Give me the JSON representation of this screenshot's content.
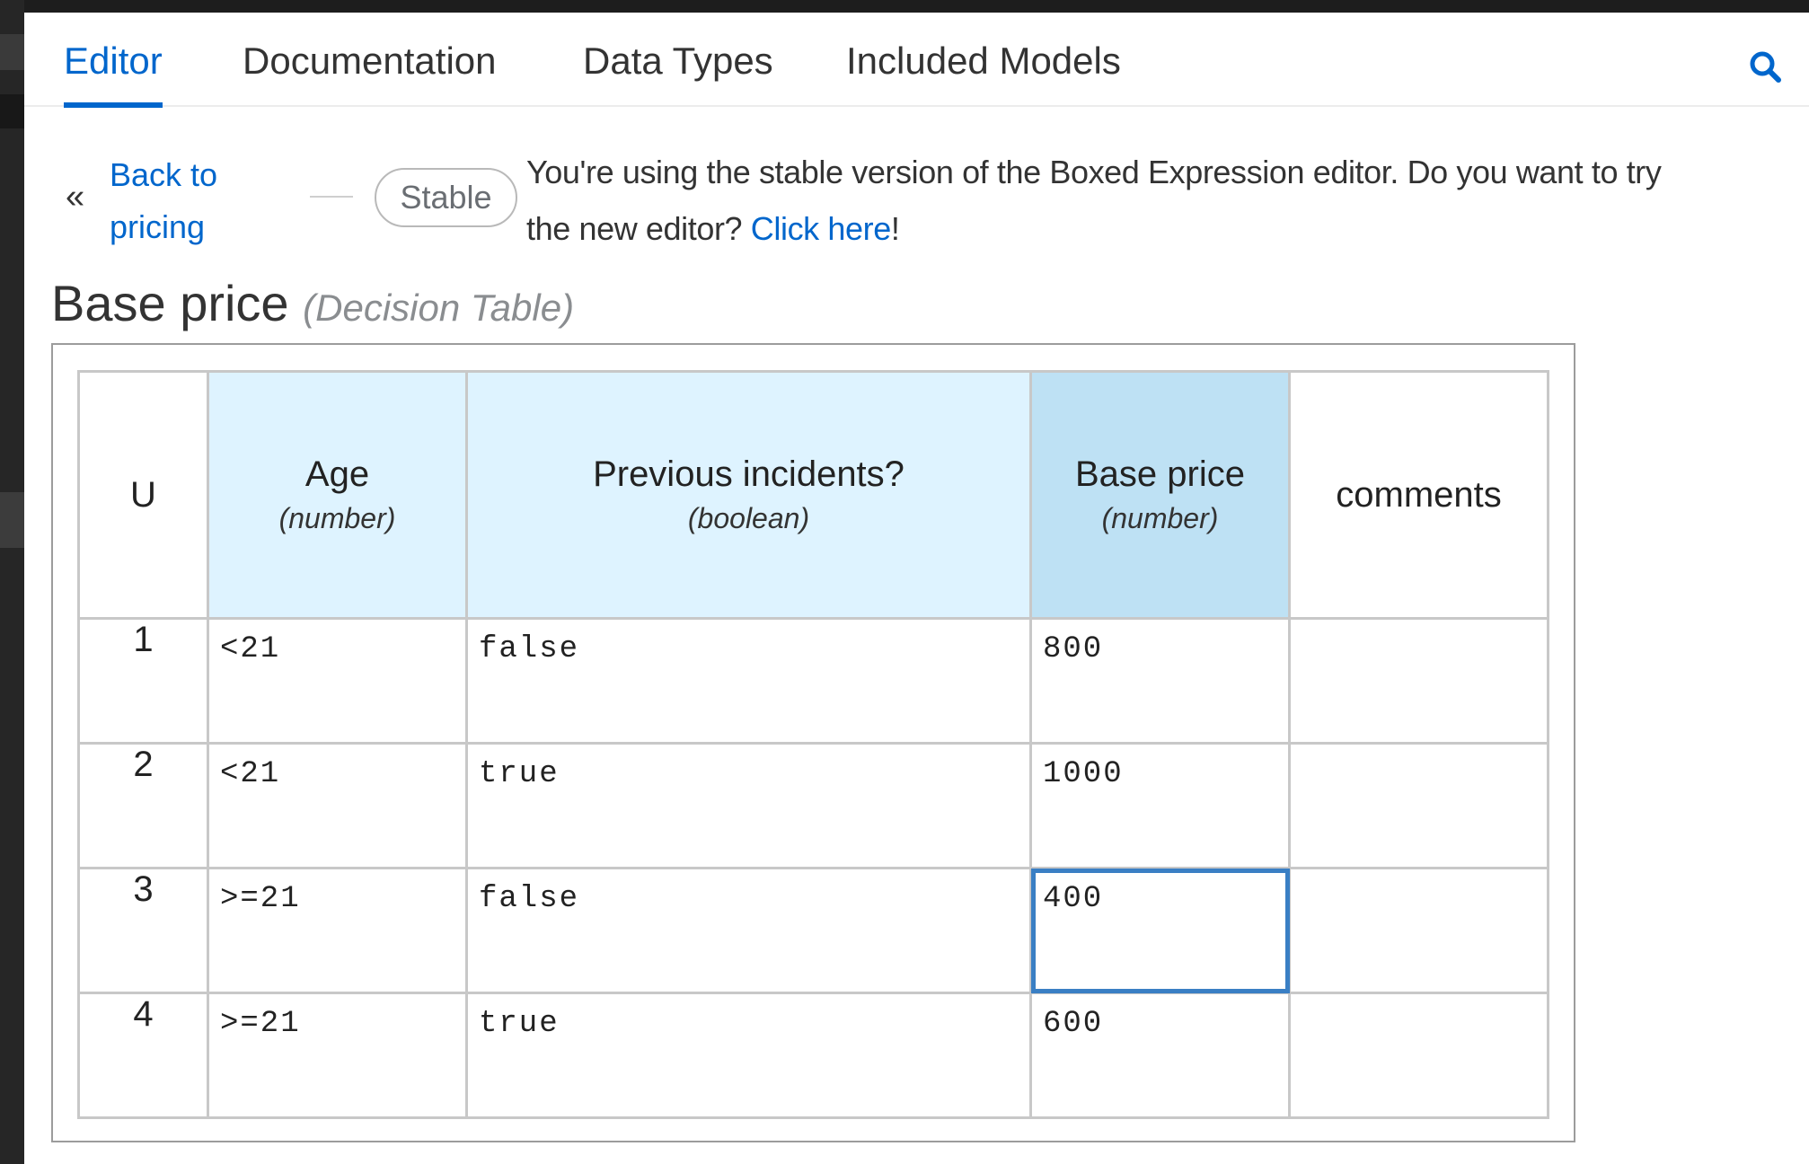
{
  "tabs": [
    {
      "label": "Editor",
      "active": true
    },
    {
      "label": "Documentation",
      "active": false
    },
    {
      "label": "Data Types",
      "active": false
    },
    {
      "label": "Included Models",
      "active": false
    }
  ],
  "back_link": {
    "line1": "Back to",
    "line2": "pricing"
  },
  "badge": "Stable",
  "notice": {
    "line1": "You're using the stable version of the Boxed Expression editor. Do you want to try",
    "line2_before": "the new editor? ",
    "link": "Click here",
    "line2_after": "!"
  },
  "expression": {
    "name": "Base price",
    "type": "(Decision Table)"
  },
  "decision_table": {
    "hit_policy": "U",
    "columns": [
      {
        "name": "Age",
        "type": "(number)"
      },
      {
        "name": "Previous incidents?",
        "type": "(boolean)"
      },
      {
        "name": "Base price",
        "type": "(number)"
      },
      {
        "name": "comments"
      }
    ],
    "rows": [
      {
        "num": "1",
        "age": "<21",
        "incidents": "false",
        "price": "800",
        "comments": ""
      },
      {
        "num": "2",
        "age": "<21",
        "incidents": "true",
        "price": "1000",
        "comments": ""
      },
      {
        "num": "3",
        "age": ">=21",
        "incidents": "false",
        "price": "400",
        "comments": ""
      },
      {
        "num": "4",
        "age": ">=21",
        "incidents": "true",
        "price": "600",
        "comments": ""
      }
    ]
  },
  "colors": {
    "accent": "#0066cc",
    "input_header": "#def3ff",
    "output_header": "#bee1f4",
    "selection": "#3a7fc4"
  }
}
